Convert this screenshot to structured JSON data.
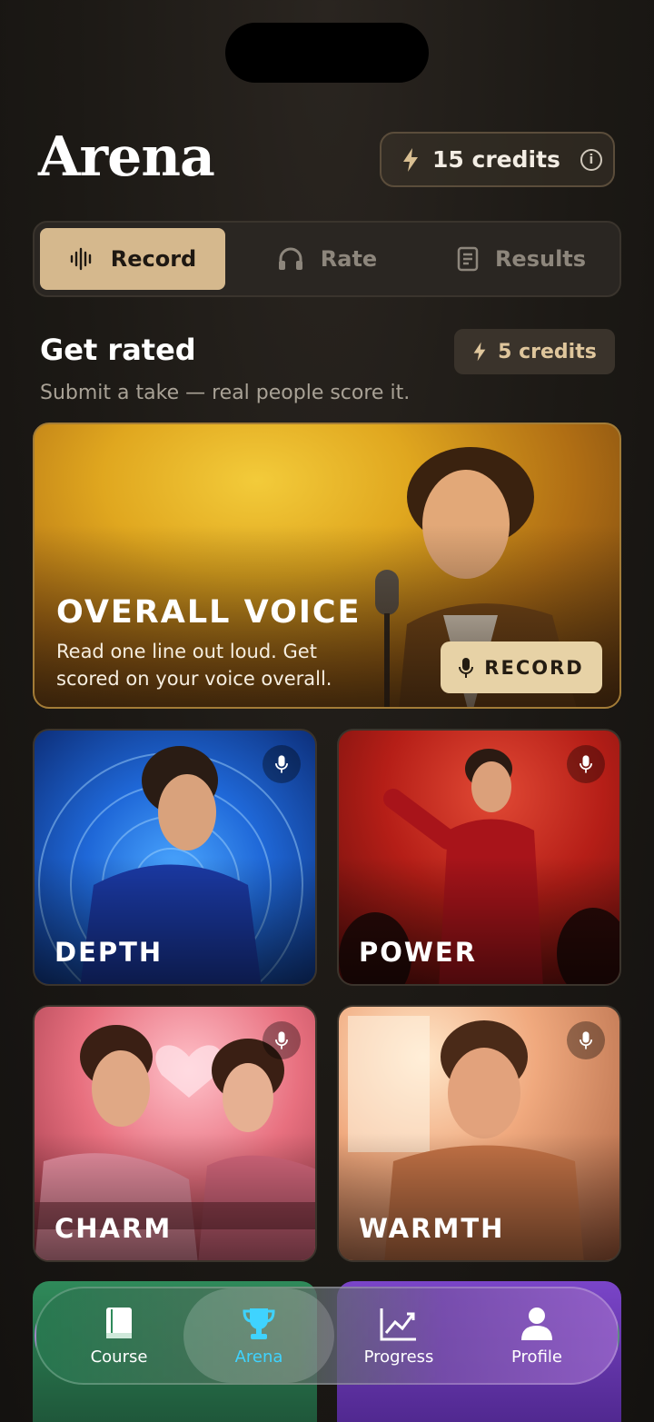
{
  "header": {
    "title": "Arena",
    "credits_label": "15 credits"
  },
  "tabs": [
    {
      "label": "Record",
      "active": true
    },
    {
      "label": "Rate",
      "active": false
    },
    {
      "label": "Results",
      "active": false
    }
  ],
  "section": {
    "title": "Get rated",
    "cost_label": "5 credits",
    "subtitle": "Submit a take — real people score it."
  },
  "hero": {
    "title": "OVERALL VOICE",
    "description": "Read one line out loud. Get scored on your voice overall.",
    "button_label": "RECORD"
  },
  "cards": [
    {
      "label": "DEPTH"
    },
    {
      "label": "POWER"
    },
    {
      "label": "CHARM"
    },
    {
      "label": "WARMTH"
    }
  ],
  "nav": [
    {
      "label": "Course",
      "icon": "book-icon"
    },
    {
      "label": "Arena",
      "icon": "trophy-icon",
      "active": true
    },
    {
      "label": "Progress",
      "icon": "chart-icon"
    },
    {
      "label": "Profile",
      "icon": "person-icon"
    }
  ],
  "colors": {
    "accent": "#d5b88d",
    "active_nav": "#3fd3ff"
  }
}
